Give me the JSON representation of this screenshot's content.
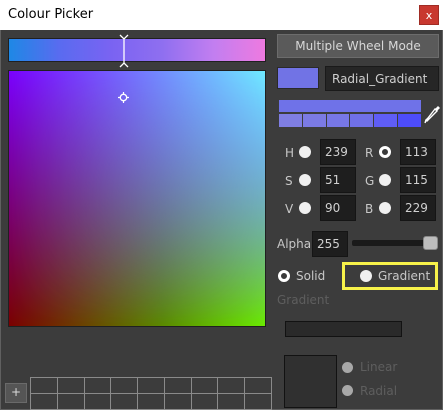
{
  "window": {
    "title": "Colour Picker",
    "close_label": "x"
  },
  "mode_button": {
    "label": "Multiple Wheel Mode"
  },
  "color_name": {
    "value": "Radial_Gradient"
  },
  "colors": {
    "current": "#7173e5",
    "swatches": [
      "#7f7ee3",
      "#7b7ae4",
      "#7777e6",
      "#7070e8",
      "#5f5df6",
      "#4d4cfa"
    ]
  },
  "hsv": {
    "h_label": "H",
    "h_value": "239",
    "s_label": "S",
    "s_value": "51",
    "v_label": "V",
    "v_value": "90"
  },
  "rgb": {
    "r_label": "R",
    "r_value": "113",
    "g_label": "G",
    "g_value": "115",
    "b_label": "B",
    "b_value": "229"
  },
  "alpha": {
    "label": "Alpha",
    "value": "255"
  },
  "fill_mode": {
    "solid_label": "Solid",
    "gradient_label": "Gradient"
  },
  "gradient": {
    "header": "Gradient",
    "linear_label": "Linear",
    "radial_label": "Radial"
  },
  "palette": {
    "add_label": "+"
  }
}
